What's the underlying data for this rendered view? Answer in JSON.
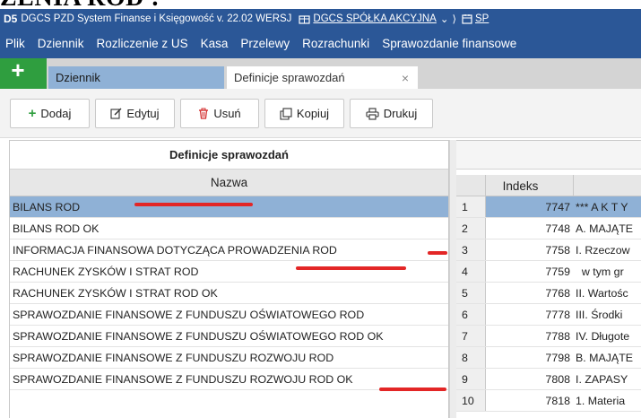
{
  "overlay_heading": "ZENIA ROD :",
  "window": {
    "logo": "D5",
    "title": "DGCS PZD System Finanse i Księgowość v. 22.02 WERSJ",
    "company": "DGCS SPÓŁKA AKCYJNA",
    "year_label": "SP"
  },
  "menu": {
    "items": [
      "Plik",
      "Dziennik",
      "Rozliczenie z US",
      "Kasa",
      "Przelewy",
      "Rozrachunki",
      "Sprawozdanie finansowe"
    ]
  },
  "tabs": {
    "plus": "+",
    "items": [
      {
        "label": "Dziennik"
      },
      {
        "label": "Definicje sprawozdań",
        "close": "×"
      }
    ]
  },
  "toolbar": {
    "add": "Dodaj",
    "edit": "Edytuj",
    "delete": "Usuń",
    "copy": "Kopiuj",
    "print": "Drukuj"
  },
  "colors": {
    "brand": "#2b5797",
    "selected_row": "#8fb1d6",
    "add_green": "#2f9e3f",
    "delete_red": "#d32f2f",
    "annotation_red": "#e32626"
  },
  "left_panel": {
    "title": "Definicje sprawozdań",
    "column": "Nazwa",
    "rows": [
      "BILANS ROD",
      "BILANS ROD OK",
      "INFORMACJA FINANSOWA DOTYCZĄCA PROWADZENIA ROD",
      "RACHUNEK ZYSKÓW I STRAT ROD",
      "RACHUNEK ZYSKÓW I STRAT ROD OK",
      "SPRAWOZDANIE FINANSOWE Z FUNDUSZU OŚWIATOWEGO ROD",
      "SPRAWOZDANIE FINANSOWE Z FUNDUSZU OŚWIATOWEGO ROD OK",
      "SPRAWOZDANIE FINANSOWE Z FUNDUSZU ROZWOJU ROD",
      "SPRAWOZDANIE FINANSOWE Z FUNDUSZU ROZWOJU ROD OK"
    ],
    "selected_index": 0
  },
  "right_panel": {
    "column_index": "Indeks",
    "rows": [
      {
        "num": "1",
        "index": "7747",
        "name": "*** A K T Y"
      },
      {
        "num": "2",
        "index": "7748",
        "name": "A. MAJĄTE"
      },
      {
        "num": "3",
        "index": "7758",
        "name": "I. Rzeczow"
      },
      {
        "num": "4",
        "index": "7759",
        "name": "  w tym gr"
      },
      {
        "num": "5",
        "index": "7768",
        "name": "II. Wartośc"
      },
      {
        "num": "6",
        "index": "7778",
        "name": "III. Środki"
      },
      {
        "num": "7",
        "index": "7788",
        "name": "IV. Długote"
      },
      {
        "num": "8",
        "index": "7798",
        "name": "B. MAJĄTE"
      },
      {
        "num": "9",
        "index": "7808",
        "name": "I. ZAPASY"
      },
      {
        "num": "10",
        "index": "7818",
        "name": "1. Materia"
      }
    ],
    "selected_index": 0
  }
}
